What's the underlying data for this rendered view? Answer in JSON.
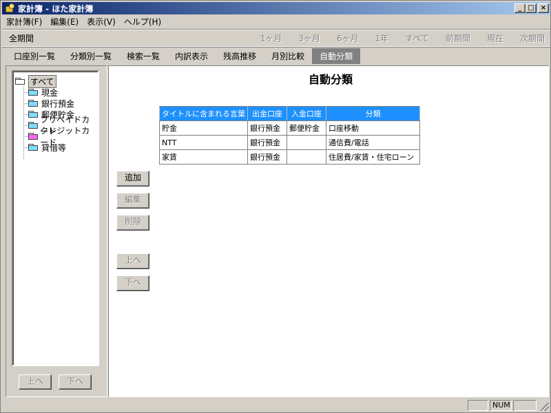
{
  "window": {
    "title": "家計簿 - ほた家計簿",
    "controls": {
      "minimize": "_",
      "maximize": "□",
      "close": "×"
    }
  },
  "menu": [
    "家計簿(F)",
    "編集(E)",
    "表示(V)",
    "ヘルプ(H)"
  ],
  "period": {
    "label": "全期間",
    "options": [
      "1ヶ月",
      "3ヶ月",
      "6ヶ月",
      "1年",
      "すべて",
      "前期間",
      "現在",
      "次期間"
    ]
  },
  "tabs": [
    {
      "label": "口座別一覧",
      "active": false
    },
    {
      "label": "分類別一覧",
      "active": false
    },
    {
      "label": "検索一覧",
      "active": false
    },
    {
      "label": "内訳表示",
      "active": false
    },
    {
      "label": "残高推移",
      "active": false
    },
    {
      "label": "月別比較",
      "active": false
    },
    {
      "label": "自動分類",
      "active": true
    }
  ],
  "tree": {
    "root": "すべて",
    "items": [
      {
        "label": "現金",
        "color": "#7fdfff"
      },
      {
        "label": "銀行預金",
        "color": "#7fdfff"
      },
      {
        "label": "郵便貯金",
        "color": "#7fdfff"
      },
      {
        "label": "プリペイドカード",
        "color": "#7fdfff"
      },
      {
        "label": "クレジットカード",
        "color": "#ff66ff"
      },
      {
        "label": "貸借等",
        "color": "#7fdfff"
      }
    ]
  },
  "left_buttons": {
    "up": "上へ",
    "down": "下へ"
  },
  "main": {
    "title": "自動分類",
    "table": {
      "headers": [
        "タイトルに含まれる言葉",
        "出金口座",
        "入金口座",
        "分類"
      ],
      "rows": [
        [
          "貯金",
          "銀行預金",
          "郵便貯金",
          "口座移動"
        ],
        [
          "NTT",
          "銀行預金",
          "",
          "通信費/電話"
        ],
        [
          "家賃",
          "銀行預金",
          "",
          "住居費/家賃・住宅ローン"
        ]
      ]
    },
    "buttons": {
      "add": "追加",
      "edit": "編集",
      "delete": "削除",
      "up": "上へ",
      "down": "下へ"
    }
  },
  "status": {
    "num": "NUM"
  },
  "colors": {
    "header_blue": "#1e90ff",
    "active_tab": "#808080"
  }
}
